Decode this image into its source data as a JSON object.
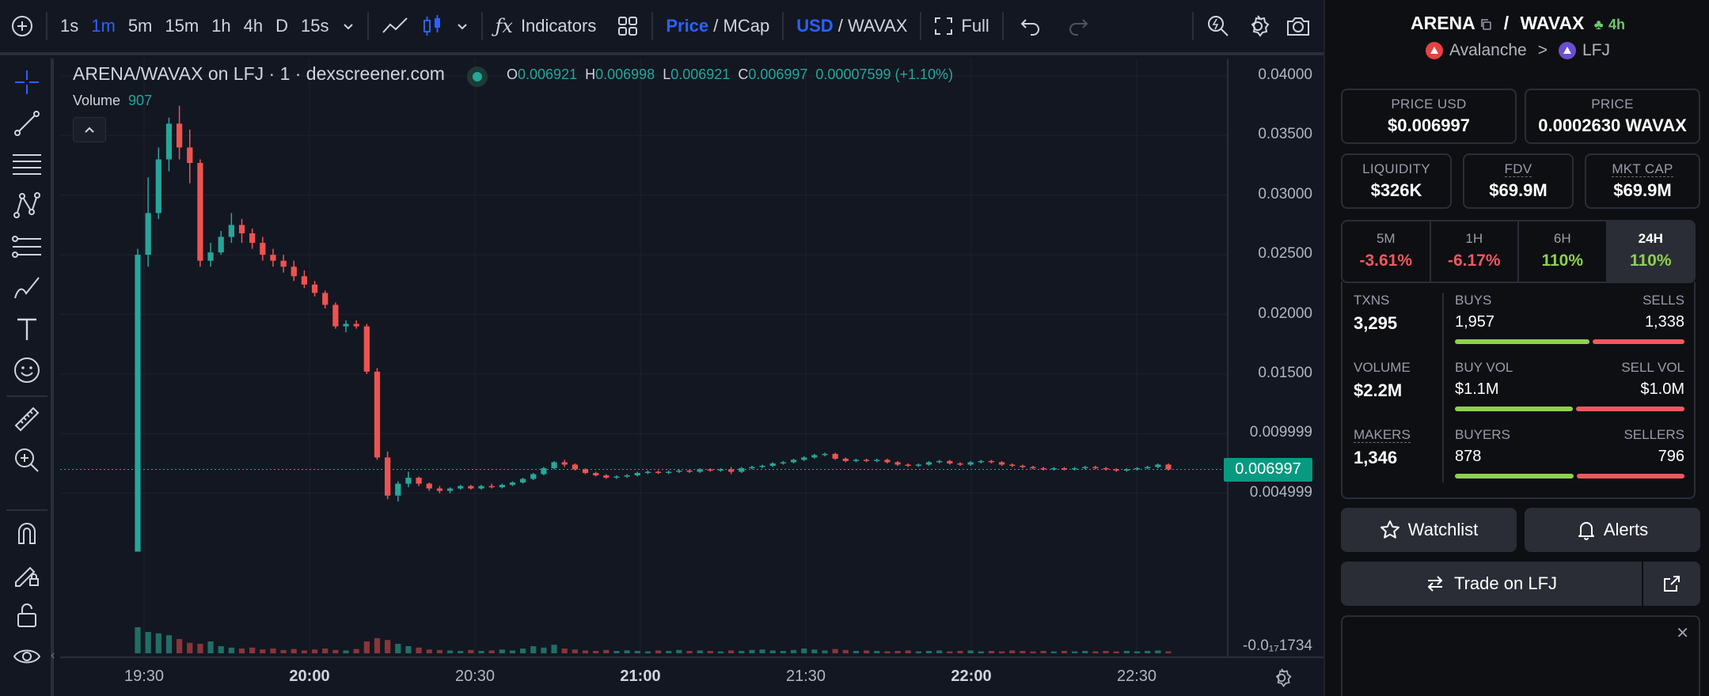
{
  "toolbar": {
    "intervals": [
      "1s",
      "1m",
      "5m",
      "15m",
      "1h",
      "4h",
      "D",
      "15s"
    ],
    "active_interval": "1m",
    "indicators_label": "Indicators",
    "price_label": "Price",
    "mcap_label": "MCap",
    "usd_label": "USD",
    "wavax_label": "WAVAX",
    "full_label": "Full",
    "separator": " / "
  },
  "legend": {
    "title": "ARENA/WAVAX on LFJ · 1 · dexscreener.com",
    "o_label": "O",
    "o": "0.006921",
    "h_label": "H",
    "h": "0.006998",
    "l_label": "L",
    "l": "0.006921",
    "c_label": "C",
    "c": "0.006997",
    "change": "0.00007599 (+1.10%)",
    "volume_label": "Volume",
    "volume": "907"
  },
  "price_axis": {
    "ticks": [
      "0.04000",
      "0.03500",
      "0.03000",
      "0.02500",
      "0.02000",
      "0.01500",
      "0.009999",
      "0.004999"
    ],
    "bottom_label": "-0.0₁₇1734",
    "last_price": "0.006997"
  },
  "time_axis": {
    "ticks": [
      {
        "label": "19:30",
        "bold": false
      },
      {
        "label": "20:00",
        "bold": true
      },
      {
        "label": "20:30",
        "bold": false
      },
      {
        "label": "21:00",
        "bold": true
      },
      {
        "label": "21:30",
        "bold": false
      },
      {
        "label": "22:00",
        "bold": true
      },
      {
        "label": "22:30",
        "bold": false
      }
    ]
  },
  "colors": {
    "up": "#26a69a",
    "down": "#ef5350",
    "accent": "#2962ff",
    "last_price_bg": "#089981"
  },
  "chart_data": {
    "type": "candlestick",
    "x_start": "19:30",
    "x_end": "22:36",
    "ylim": [
      0,
      0.04
    ],
    "candles": [
      [
        0.0001,
        0.0255,
        0.0001,
        0.025
      ],
      [
        0.025,
        0.0315,
        0.024,
        0.0285
      ],
      [
        0.0285,
        0.034,
        0.028,
        0.033
      ],
      [
        0.033,
        0.0365,
        0.032,
        0.036
      ],
      [
        0.036,
        0.0375,
        0.033,
        0.034
      ],
      [
        0.034,
        0.0355,
        0.031,
        0.0327
      ],
      [
        0.0327,
        0.033,
        0.024,
        0.0245
      ],
      [
        0.0245,
        0.026,
        0.024,
        0.0252
      ],
      [
        0.0252,
        0.027,
        0.025,
        0.0265
      ],
      [
        0.0265,
        0.0285,
        0.026,
        0.0275
      ],
      [
        0.0275,
        0.028,
        0.026,
        0.0268
      ],
      [
        0.0268,
        0.0272,
        0.0255,
        0.026
      ],
      [
        0.026,
        0.0265,
        0.0245,
        0.025
      ],
      [
        0.025,
        0.0255,
        0.024,
        0.0245
      ],
      [
        0.0245,
        0.025,
        0.0235,
        0.024
      ],
      [
        0.024,
        0.0245,
        0.0228,
        0.0232
      ],
      [
        0.0232,
        0.0237,
        0.0222,
        0.0225
      ],
      [
        0.0225,
        0.0228,
        0.0215,
        0.0218
      ],
      [
        0.0218,
        0.022,
        0.0205,
        0.0208
      ],
      [
        0.0208,
        0.021,
        0.0188,
        0.019
      ],
      [
        0.019,
        0.0195,
        0.0185,
        0.0192
      ],
      [
        0.0192,
        0.0195,
        0.0188,
        0.019
      ],
      [
        0.019,
        0.0192,
        0.015,
        0.0152
      ],
      [
        0.0152,
        0.0155,
        0.0078,
        0.008
      ],
      [
        0.008,
        0.0085,
        0.0045,
        0.0048
      ],
      [
        0.0048,
        0.006,
        0.0043,
        0.0058
      ],
      [
        0.0058,
        0.0068,
        0.0055,
        0.0063
      ],
      [
        0.0063,
        0.0064,
        0.0056,
        0.0058
      ],
      [
        0.0058,
        0.0059,
        0.0052,
        0.0054
      ],
      [
        0.0054,
        0.0056,
        0.005,
        0.0052
      ],
      [
        0.0052,
        0.0055,
        0.005,
        0.0054
      ],
      [
        0.0054,
        0.0057,
        0.0053,
        0.0056
      ],
      [
        0.0056,
        0.0057,
        0.0053,
        0.0054
      ],
      [
        0.0054,
        0.0057,
        0.0053,
        0.0056
      ],
      [
        0.0056,
        0.0058,
        0.0054,
        0.0055
      ],
      [
        0.0055,
        0.0058,
        0.0054,
        0.0057
      ],
      [
        0.0057,
        0.006,
        0.0056,
        0.0059
      ],
      [
        0.0059,
        0.0063,
        0.0058,
        0.0062
      ],
      [
        0.0062,
        0.0067,
        0.0061,
        0.0066
      ],
      [
        0.0066,
        0.0072,
        0.0065,
        0.0071
      ],
      [
        0.0071,
        0.0077,
        0.007,
        0.0076
      ],
      [
        0.0076,
        0.0078,
        0.0072,
        0.0074
      ],
      [
        0.0074,
        0.0075,
        0.0069,
        0.007
      ],
      [
        0.007,
        0.0071,
        0.0066,
        0.0067
      ],
      [
        0.0067,
        0.0068,
        0.0064,
        0.0065
      ],
      [
        0.0065,
        0.0066,
        0.0062,
        0.0063
      ],
      [
        0.0063,
        0.0065,
        0.0062,
        0.0064
      ],
      [
        0.0064,
        0.0066,
        0.0063,
        0.0065
      ],
      [
        0.0065,
        0.0068,
        0.0064,
        0.0067
      ],
      [
        0.0067,
        0.0069,
        0.0066,
        0.0068
      ],
      [
        0.0068,
        0.0069,
        0.0066,
        0.0067
      ],
      [
        0.0067,
        0.0069,
        0.0066,
        0.0068
      ],
      [
        0.0068,
        0.007,
        0.0067,
        0.0069
      ],
      [
        0.0069,
        0.007,
        0.0067,
        0.0068
      ],
      [
        0.0068,
        0.0071,
        0.0067,
        0.007
      ],
      [
        0.007,
        0.0071,
        0.0068,
        0.0069
      ],
      [
        0.0069,
        0.0071,
        0.0068,
        0.007
      ],
      [
        0.007,
        0.0072,
        0.0066,
        0.0068
      ],
      [
        0.0068,
        0.0072,
        0.0067,
        0.0071
      ],
      [
        0.0071,
        0.0073,
        0.007,
        0.0072
      ],
      [
        0.0072,
        0.0074,
        0.0071,
        0.0073
      ],
      [
        0.0073,
        0.0076,
        0.0072,
        0.0075
      ],
      [
        0.0075,
        0.0077,
        0.0074,
        0.0076
      ],
      [
        0.0076,
        0.0079,
        0.0075,
        0.0078
      ],
      [
        0.0078,
        0.0081,
        0.0077,
        0.008
      ],
      [
        0.008,
        0.0083,
        0.0079,
        0.0082
      ],
      [
        0.0082,
        0.0084,
        0.0081,
        0.0083
      ],
      [
        0.0083,
        0.0084,
        0.0078,
        0.0079
      ],
      [
        0.0079,
        0.008,
        0.0076,
        0.0077
      ],
      [
        0.0077,
        0.0079,
        0.0076,
        0.0078
      ],
      [
        0.0078,
        0.0079,
        0.0076,
        0.0077
      ],
      [
        0.0077,
        0.0079,
        0.0076,
        0.0078
      ],
      [
        0.0078,
        0.0079,
        0.0075,
        0.0076
      ],
      [
        0.0076,
        0.0077,
        0.0073,
        0.0074
      ],
      [
        0.0074,
        0.0075,
        0.0072,
        0.0073
      ],
      [
        0.0073,
        0.0075,
        0.0072,
        0.0074
      ],
      [
        0.0074,
        0.0077,
        0.0073,
        0.0076
      ],
      [
        0.0076,
        0.0078,
        0.0075,
        0.0077
      ],
      [
        0.0077,
        0.0078,
        0.0074,
        0.0075
      ],
      [
        0.0075,
        0.0076,
        0.0073,
        0.0074
      ],
      [
        0.0074,
        0.0077,
        0.0073,
        0.0076
      ],
      [
        0.0076,
        0.0078,
        0.0075,
        0.0077
      ],
      [
        0.0077,
        0.0078,
        0.0075,
        0.0076
      ],
      [
        0.0076,
        0.0077,
        0.0073,
        0.0074
      ],
      [
        0.0074,
        0.0075,
        0.0072,
        0.0073
      ],
      [
        0.0073,
        0.0074,
        0.0071,
        0.0072
      ],
      [
        0.0072,
        0.0073,
        0.007,
        0.0071
      ],
      [
        0.0071,
        0.0072,
        0.0069,
        0.007
      ],
      [
        0.007,
        0.0072,
        0.0069,
        0.0071
      ],
      [
        0.0071,
        0.0072,
        0.0069,
        0.007
      ],
      [
        0.007,
        0.0072,
        0.0069,
        0.0071
      ],
      [
        0.0071,
        0.0073,
        0.007,
        0.0072
      ],
      [
        0.0072,
        0.0073,
        0.007,
        0.0071
      ],
      [
        0.0071,
        0.0072,
        0.0069,
        0.007
      ],
      [
        0.007,
        0.0071,
        0.0068,
        0.0069
      ],
      [
        0.0069,
        0.0071,
        0.0068,
        0.007
      ],
      [
        0.007,
        0.0072,
        0.0069,
        0.0071
      ],
      [
        0.0071,
        0.0073,
        0.007,
        0.0072
      ],
      [
        0.0072,
        0.0075,
        0.0071,
        0.0074
      ],
      [
        0.0074,
        0.0075,
        0.0069,
        0.007
      ]
    ],
    "volumes": [
      0.55,
      0.45,
      0.42,
      0.38,
      0.3,
      0.22,
      0.2,
      0.25,
      0.15,
      0.12,
      0.1,
      0.12,
      0.08,
      0.1,
      0.07,
      0.09,
      0.06,
      0.08,
      0.1,
      0.07,
      0.06,
      0.09,
      0.25,
      0.32,
      0.28,
      0.2,
      0.15,
      0.12,
      0.08,
      0.07,
      0.06,
      0.05,
      0.07,
      0.05,
      0.06,
      0.08,
      0.06,
      0.1,
      0.15,
      0.12,
      0.18,
      0.1,
      0.08,
      0.06,
      0.05,
      0.07,
      0.05,
      0.06,
      0.05,
      0.04,
      0.06,
      0.05,
      0.07,
      0.05,
      0.06,
      0.05,
      0.04,
      0.06,
      0.05,
      0.07,
      0.08,
      0.06,
      0.05,
      0.07,
      0.1,
      0.08,
      0.06,
      0.09,
      0.07,
      0.05,
      0.06,
      0.05,
      0.04,
      0.05,
      0.06,
      0.04,
      0.05,
      0.06,
      0.04,
      0.05,
      0.06,
      0.04,
      0.05,
      0.04,
      0.06,
      0.05,
      0.04,
      0.05,
      0.04,
      0.05,
      0.04,
      0.05,
      0.04,
      0.05,
      0.04,
      0.05,
      0.04,
      0.05,
      0.06,
      0.04
    ]
  },
  "panel": {
    "base": "ARENA",
    "quote": "WAVAX",
    "slash": "/",
    "age": "4h",
    "chain": "Avalanche",
    "dex": "LFJ",
    "chevron": ">",
    "price_usd_label": "PRICE USD",
    "price_usd": "$0.006997",
    "price_label": "PRICE",
    "price_native": "0.0002630 WAVAX",
    "liquidity_label": "LIQUIDITY",
    "liquidity": "$326K",
    "fdv_label": "FDV",
    "fdv": "$69.9M",
    "mcap_label": "MKT CAP",
    "mcap": "$69.9M",
    "timeframes": [
      {
        "label": "5M",
        "value": "-3.61%",
        "dir": "neg"
      },
      {
        "label": "1H",
        "value": "-6.17%",
        "dir": "neg"
      },
      {
        "label": "6H",
        "value": "110%",
        "dir": "pos"
      },
      {
        "label": "24H",
        "value": "110%",
        "dir": "pos"
      }
    ],
    "txns_label": "TXNS",
    "txns": "3,295",
    "buys_label": "BUYS",
    "buys": "1,957",
    "sells_label": "SELLS",
    "sells": "1,338",
    "buys_ratio": 0.594,
    "volume_label": "VOLUME",
    "volume": "$2.2M",
    "buy_vol_label": "BUY VOL",
    "buy_vol": "$1.1M",
    "sell_vol_label": "SELL VOL",
    "sell_vol": "$1.0M",
    "buy_vol_ratio": 0.52,
    "makers_label": "MAKERS",
    "makers": "1,346",
    "buyers_label": "BUYERS",
    "buyers": "878",
    "sellers_label": "SELLERS",
    "sellers": "796",
    "buyers_ratio": 0.525,
    "watchlist_label": "Watchlist",
    "alerts_label": "Alerts",
    "trade_label": "Trade on LFJ",
    "close_symbol": "✕"
  }
}
